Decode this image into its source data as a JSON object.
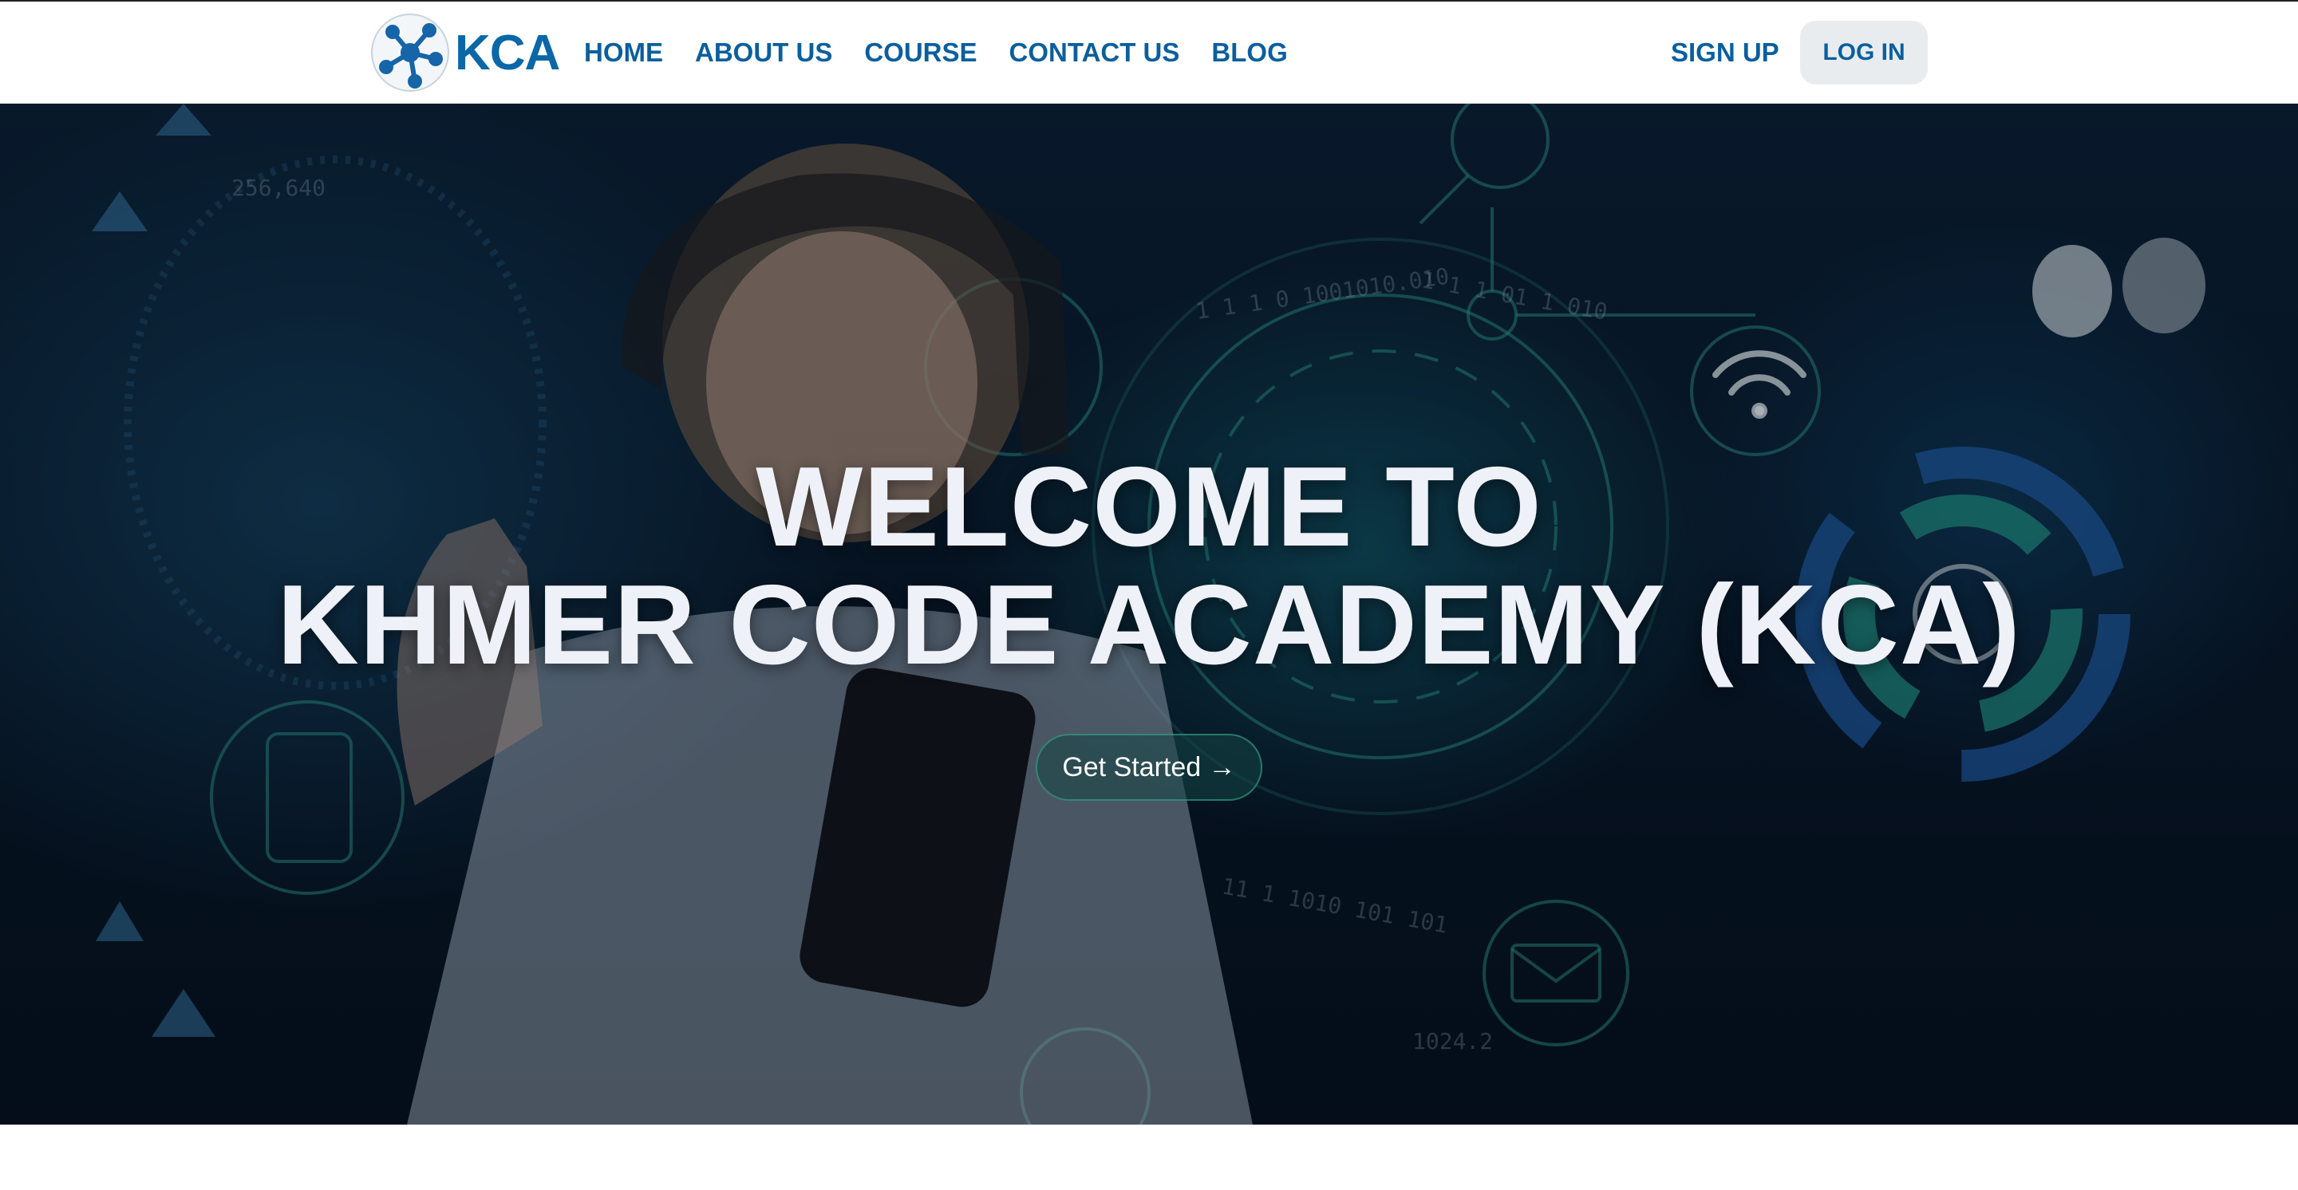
{
  "brand": {
    "name": "KCA"
  },
  "nav": {
    "links": [
      "HOME",
      "ABOUT US",
      "COURSE",
      "CONTACT US",
      "BLOG"
    ],
    "signup_label": "SIGN UP",
    "login_label": "LOG IN"
  },
  "hero": {
    "title_line1": "WELCOME TO",
    "title_line2": "KHMER CODE ACADEMY (KCA)",
    "cta_label": "Get Started →"
  },
  "colors": {
    "brand_blue": "#0a67a8",
    "nav_text": "#0a5f9e",
    "hero_bg": "#0a1f33",
    "accent_teal": "#2fa79a"
  }
}
